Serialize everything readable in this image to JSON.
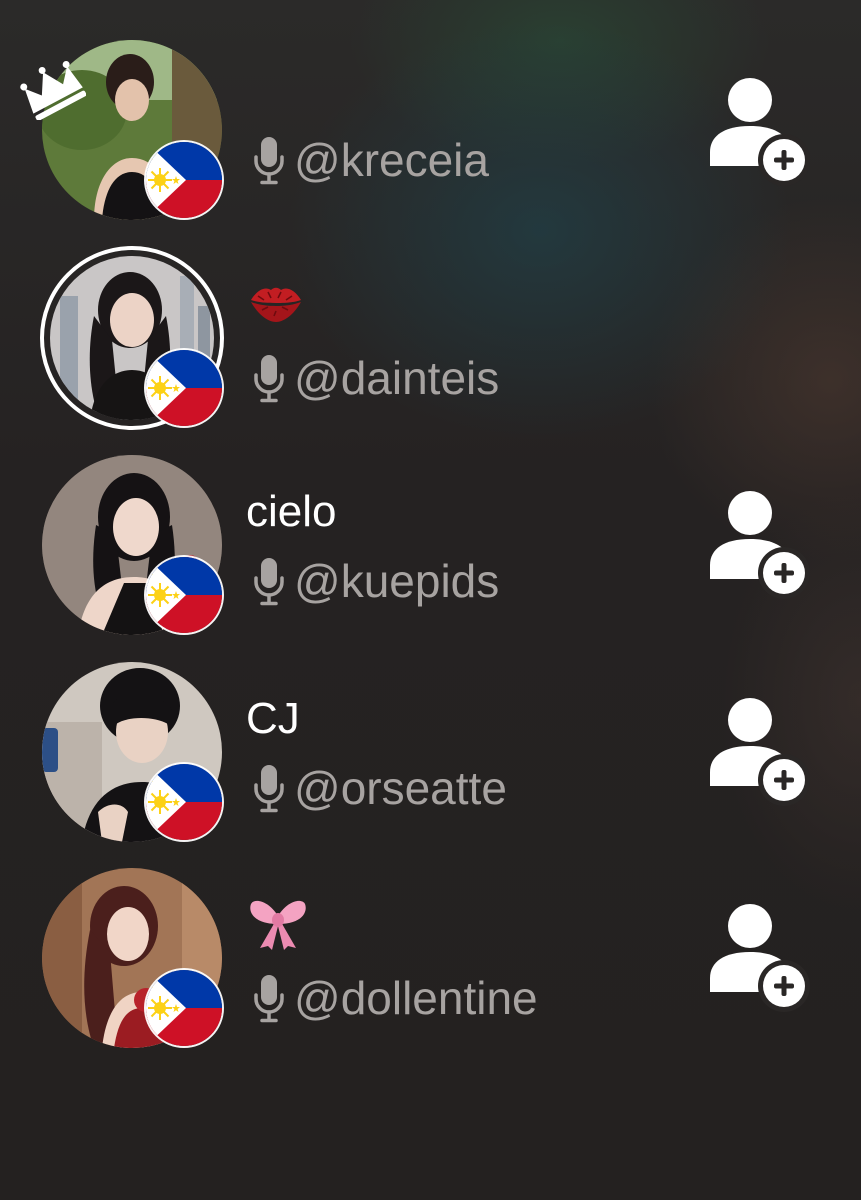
{
  "users": [
    {
      "display_name": "",
      "handle": "@kreceia",
      "badge_icon": "crown-icon",
      "flag": "philippines-flag-icon",
      "has_follow_button": true
    },
    {
      "display_name": "",
      "emoji": "kiss-mark-emoji",
      "handle": "@dainteis",
      "flag": "philippines-flag-icon",
      "has_follow_button": false
    },
    {
      "display_name": "cielo",
      "handle": "@kuepids",
      "flag": "philippines-flag-icon",
      "has_follow_button": true
    },
    {
      "display_name": "CJ",
      "handle": "@orseatte",
      "flag": "philippines-flag-icon",
      "has_follow_button": true
    },
    {
      "display_name": "",
      "emoji": "pink-ribbon-emoji",
      "handle": "@dollentine",
      "flag": "philippines-flag-icon",
      "has_follow_button": true
    }
  ],
  "colors": {
    "background": "#262323",
    "name_text": "#ffffff",
    "handle_text": "#a7a3a1",
    "icon": "#ffffff",
    "flag_blue": "#0038a8",
    "flag_red": "#ce1126",
    "flag_sun": "#fcd116"
  }
}
